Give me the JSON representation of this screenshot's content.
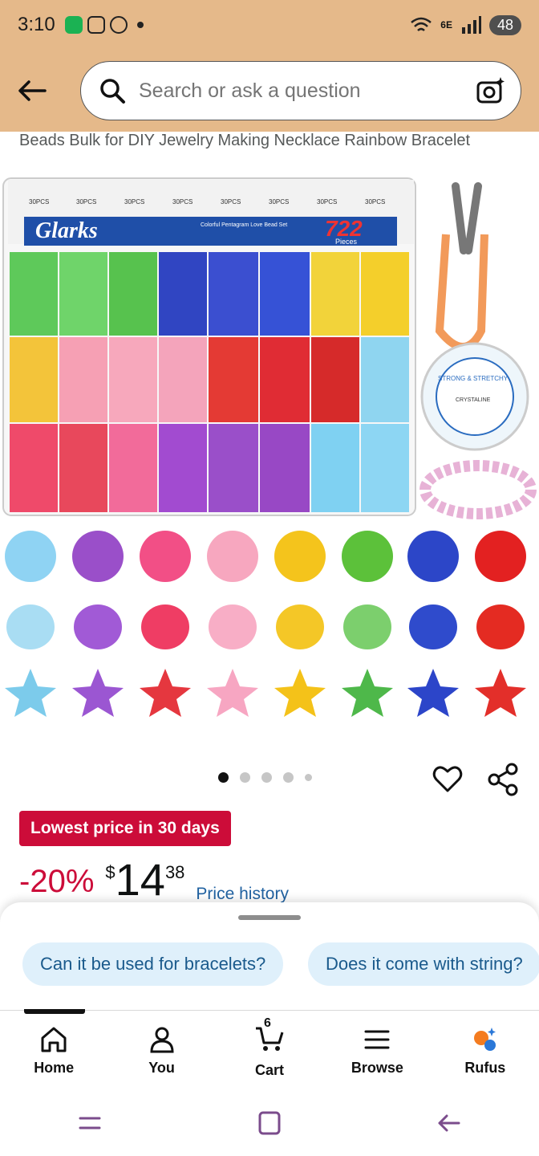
{
  "status": {
    "time": "3:10",
    "network": "6E",
    "battery": "48"
  },
  "search": {
    "placeholder": "Search or ask a question"
  },
  "product": {
    "title_fragment": "Beads Bulk for DIY Jewelry Making Necklace Rainbow Bracelet",
    "image": {
      "box_label": "30PCS",
      "brand": "Glarks",
      "set_name": "Colorful Pentagram Love Bead Set",
      "piece_count": "722",
      "pieces_label": "Pieces",
      "string_label": "STRONG & STRETCHY",
      "string_brand": "CRYSTALINE"
    },
    "carousel": {
      "dots": 5,
      "active": 1
    },
    "deal_badge": "Lowest price in 30 days",
    "discount": "-20%",
    "price_symbol": "$",
    "price_whole": "14",
    "price_fraction": "38",
    "price_history_link": "Price history"
  },
  "sheet": {
    "chips": [
      "Can it be used for bracelets?",
      "Does it come with string?"
    ]
  },
  "nav": {
    "items": [
      {
        "label": "Home",
        "icon": "home-icon"
      },
      {
        "label": "You",
        "icon": "person-icon"
      },
      {
        "label": "Cart",
        "icon": "cart-icon",
        "count": "6"
      },
      {
        "label": "Browse",
        "icon": "menu-icon"
      },
      {
        "label": "Rufus",
        "icon": "rufus-icon"
      }
    ]
  },
  "colors": {
    "header_bg": "#e5b98a",
    "deal_red": "#cc0c39",
    "link_blue": "#2162a1",
    "chip_bg": "#dff0fb"
  }
}
